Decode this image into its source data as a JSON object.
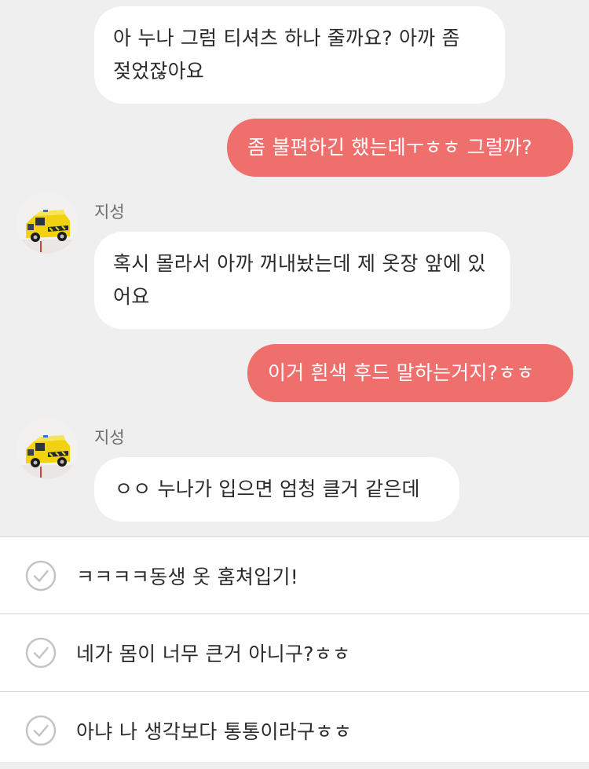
{
  "messages": [
    {
      "side": "in",
      "text": "아 누나 그럼 티셔츠 하나 줄까요? 아까 좀 젖었잖아요"
    },
    {
      "side": "out",
      "text": "좀 불편하긴 했는데ㅜㅎㅎ 그럴까?"
    },
    {
      "side": "in",
      "sender": "지성",
      "text": "혹시 몰라서 아까 꺼내놨는데 제 옷장 앞에 있어요"
    },
    {
      "side": "out",
      "text": "이거 흰색 후드 말하는거지?ㅎㅎ"
    },
    {
      "side": "in",
      "sender": "지성",
      "text": "ㅇㅇ 누나가 입으면 엄청 클거 같은데"
    }
  ],
  "avatar_icon": "ambulance-toy-avatar",
  "choices": [
    {
      "label": "ㅋㅋㅋㅋ동생 옷 훔쳐입기!"
    },
    {
      "label": "네가 몸이 너무 큰거 아니구?ㅎㅎ"
    },
    {
      "label": "아냐 나 생각보다 통통이라구ㅎㅎ"
    }
  ],
  "colors": {
    "background": "#efefef",
    "incoming_bubble": "#ffffff",
    "outgoing_bubble": "#ef6f6c",
    "check_icon": "#c4c4c4"
  }
}
